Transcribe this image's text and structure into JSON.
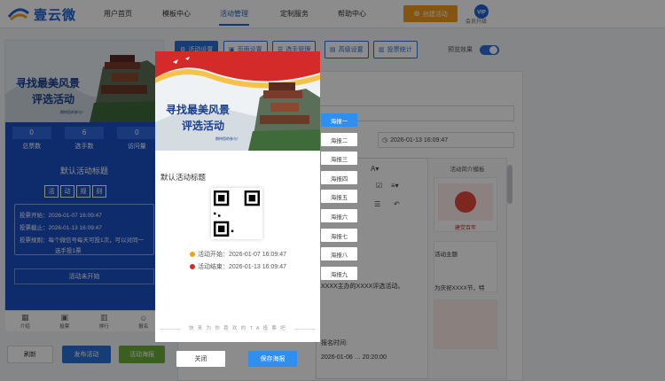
{
  "brand": {
    "name": "壹云微"
  },
  "nav": {
    "items": [
      "用户首页",
      "模板中心",
      "活动管理",
      "定制服务",
      "帮助中心"
    ],
    "create_label": "创建活动",
    "vip_badge": "VIP",
    "upgrade_label": "会员升级"
  },
  "toolbar": {
    "buttons": [
      "活动设置",
      "页面设置",
      "选手管理",
      "高级设置",
      "投票统计"
    ],
    "preview_effect_label": "预览效果"
  },
  "phone_preview": {
    "banner_title_line1": "寻找最美风景",
    "banner_title_line2": "评选活动",
    "banner_caption": "期待您的参与！",
    "stats": [
      {
        "value": "0",
        "label": "总票数"
      },
      {
        "value": "6",
        "label": "选手数"
      },
      {
        "value": "0",
        "label": "访问量"
      }
    ],
    "title": "默认活动标题",
    "tag_chars": [
      "活",
      "动",
      "规",
      "则"
    ],
    "vote_start": "投票开始：2026-01-07 16:09:47",
    "vote_end": "投票截止：2026-01-13 16:09:47",
    "vote_rule_line1": "投票规则：每个微信号每天可投1次，可以对同一",
    "vote_rule_line2": "选手投1票",
    "status": "活动未开始",
    "tabs": [
      "介绍",
      "投票",
      "排行",
      "报名"
    ]
  },
  "left_buttons": {
    "refresh": "刷新",
    "publish": "发布活动",
    "poster": "活动海报"
  },
  "editor": {
    "date_value": "2026-01-13 16:09:47",
    "template_panel_title": "活动简介模板",
    "template_card2_label": "活动主题",
    "template_card1_text": "建党百年",
    "template_card2_text": "为庆祝XXXX节，特",
    "body_line1": "XXXX主办的XXXX评选活动。",
    "body_line2": "报名时间:",
    "body_line3": "2026-01-06 … 20:20:00"
  },
  "poster_modal": {
    "banner_title_line1": "寻找最美风景",
    "banner_title_line2": "评选活动",
    "banner_caption": "期待您的参与！",
    "title": "默认活动标题",
    "start_time": "活动开始：2026-01-07 16:09:47",
    "end_time": "活动结束：2026-01-13 16:09:47",
    "footer": "快 来 为 你 喜 欢 的 T A 投 票 吧",
    "options": [
      "海报一",
      "海报二",
      "海报三",
      "海报四",
      "海报五",
      "海报六",
      "海报七",
      "海报八",
      "海报九"
    ],
    "selected_option": "海报一",
    "close_label": "关闭",
    "save_label": "保存海报"
  },
  "colors": {
    "primary": "#2a6fd8",
    "orange": "#f29a1a",
    "green": "#6aae3a",
    "poster_red": "#d42a2a",
    "select_blue": "#2e8ff0"
  }
}
